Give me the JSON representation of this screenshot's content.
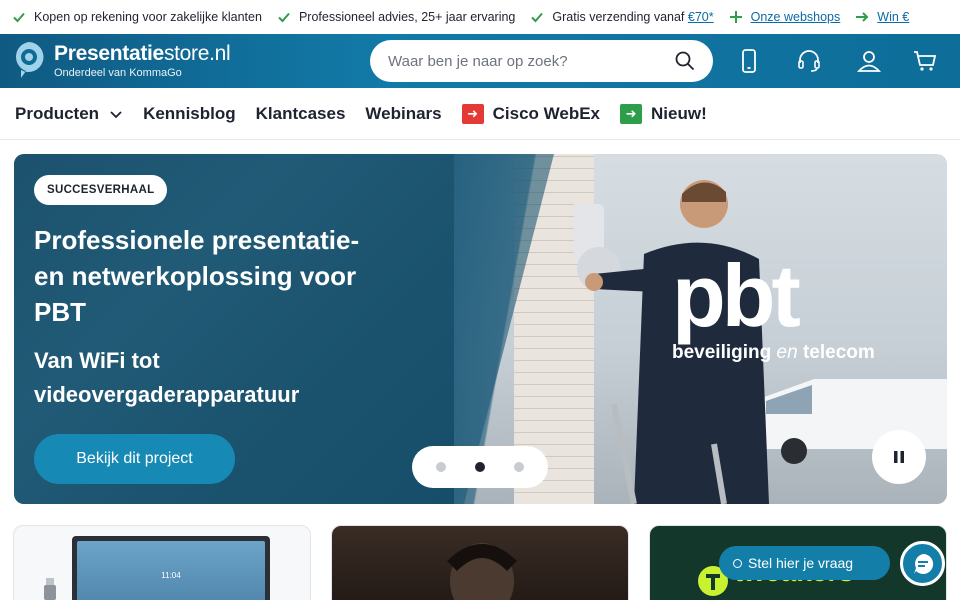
{
  "usp_bar": {
    "items": [
      {
        "text": "Kopen op rekening voor zakelijke klanten",
        "icon": "check-icon"
      },
      {
        "text": "Professioneel advies, 25+ jaar ervaring",
        "icon": "check-icon"
      },
      {
        "text": "Gratis verzending vanaf ",
        "link": "€70*",
        "icon": "check-icon"
      },
      {
        "text": "",
        "link": "Onze webshops",
        "icon": "plus-icon"
      },
      {
        "text": "",
        "link": "Win €",
        "icon": "arrow-right-icon"
      }
    ]
  },
  "header": {
    "logo": {
      "bold": "Presentatie",
      "light": "store.nl",
      "subtitle": "Onderdeel van KommaGo"
    },
    "search": {
      "placeholder": "Waar ben je naar op zoek?"
    },
    "icons": [
      "phone-icon",
      "headset-icon",
      "user-icon",
      "cart-icon"
    ]
  },
  "nav": {
    "items": [
      {
        "label": "Producten",
        "has_dropdown": true
      },
      {
        "label": "Kennisblog"
      },
      {
        "label": "Klantcases"
      },
      {
        "label": "Webinars"
      },
      {
        "label": "Cisco WebEx",
        "tag_color": "#e53935"
      },
      {
        "label": "Nieuw!",
        "tag_color": "#2e9e4a"
      }
    ]
  },
  "hero": {
    "badge": "SUCCESVERHAAL",
    "title": "Professionele presentatie- en netwerkoplossing voor PBT",
    "subtitle": "Van WiFi tot videovergaderapparatuur",
    "cta": "Bekijk dit project",
    "brand": {
      "name": "pbt",
      "tagline_a": "beveiliging ",
      "tagline_em": "en",
      "tagline_b": " telecom"
    },
    "slides": {
      "count": 3,
      "active_index": 2
    }
  },
  "cards": [
    {
      "image_time": "11:04"
    },
    {},
    {
      "brand": "tweakers"
    }
  ],
  "chat": {
    "label": "Stel hier je vraag"
  },
  "colors": {
    "primary": "#137fa9",
    "header": "#0f6a96",
    "check": "#2e9e4a"
  }
}
